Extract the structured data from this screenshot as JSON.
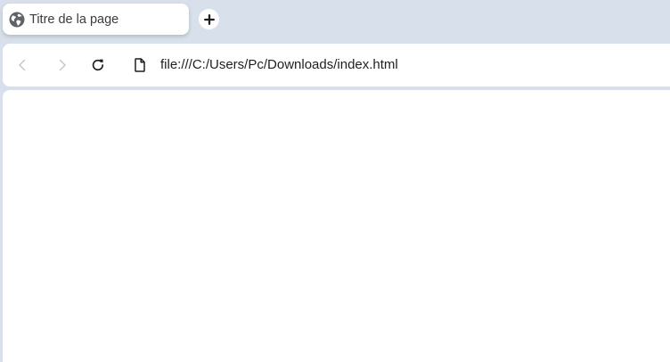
{
  "tab": {
    "title": "Titre de la page",
    "icon": "globe-icon"
  },
  "new_tab": {
    "icon": "plus-icon"
  },
  "toolbar": {
    "back_icon": "chevron-left-icon",
    "forward_icon": "chevron-right-icon",
    "reload_icon": "reload-icon",
    "back_enabled": false,
    "forward_enabled": false
  },
  "address_bar": {
    "icon": "file-icon",
    "url": "file:///C:/Users/Pc/Downloads/index.html"
  },
  "colors": {
    "frame": "#d8e1eb",
    "surface": "#ffffff",
    "disabled_icon": "#c0c4c9",
    "icon": "#1f1f1f"
  }
}
